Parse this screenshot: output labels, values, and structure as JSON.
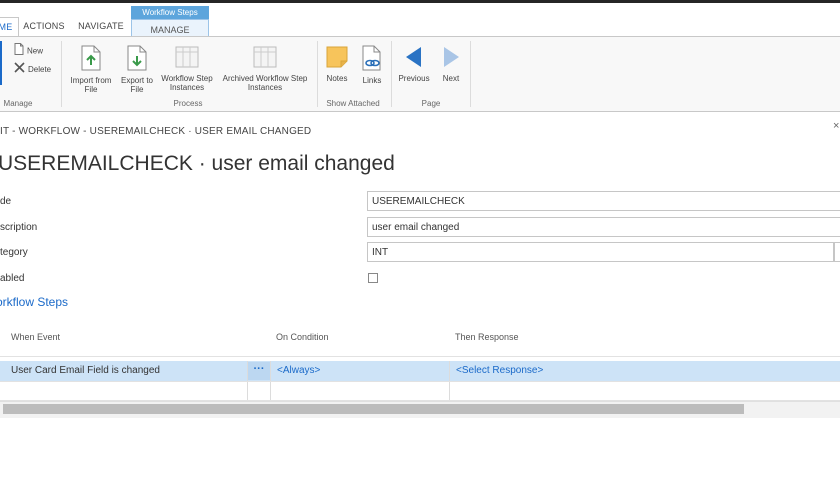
{
  "tabs": {
    "home": "ME",
    "actions": "ACTIONS",
    "navigate": "NAVIGATE",
    "context_group": "Workflow Steps",
    "manage": "MANAGE"
  },
  "ribbon": {
    "new": "New",
    "delete": "Delete",
    "import_from_file": [
      "Import from",
      "File"
    ],
    "export_to_file": [
      "Export to",
      "File"
    ],
    "workflow_step_instances": [
      "Workflow Step",
      "Instances"
    ],
    "archived_workflow_step_instances": [
      "Archived Workflow Step",
      "Instances"
    ],
    "notes": "Notes",
    "links": "Links",
    "previous": "Previous",
    "next": "Next",
    "groups": {
      "manage": "Manage",
      "process": "Process",
      "show_attached": "Show Attached",
      "page": "Page"
    }
  },
  "breadcrumb": "IT - WORKFLOW - USEREMAILCHECK · USER EMAIL CHANGED",
  "page_title": "USEREMAILCHECK · user email changed",
  "fields": {
    "code": {
      "label": "de",
      "value": "USEREMAILCHECK"
    },
    "description": {
      "label": "scription",
      "value": "user email changed"
    },
    "category": {
      "label": "tegory",
      "value": "INT"
    },
    "enabled": {
      "label": "abled",
      "checked": false
    }
  },
  "steps_section": "orkflow Steps",
  "steps_grid": {
    "columns": [
      "When Event",
      "On Condition",
      "Then Response"
    ],
    "rows": [
      {
        "when_event": "User Card Email Field is changed",
        "assist": "···",
        "on_condition": "<Always>",
        "then_response": "<Select Response>"
      }
    ]
  },
  "colors": {
    "accent": "#1b6ac9",
    "context_tab": "#5da5dc",
    "selected_row": "#cde3f7"
  }
}
